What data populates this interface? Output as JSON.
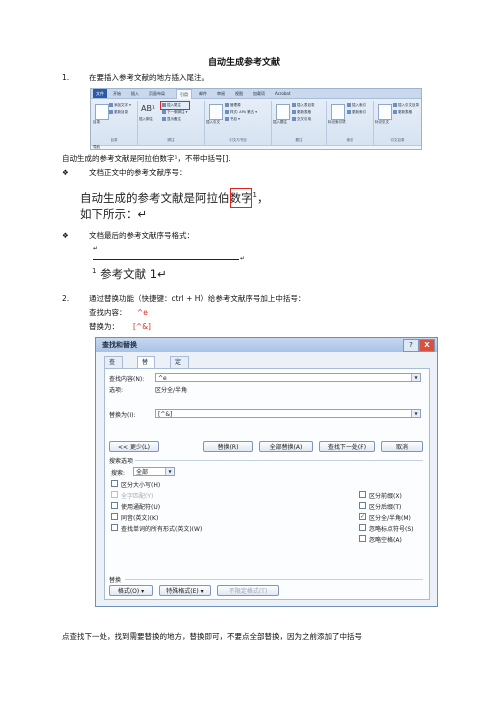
{
  "doc": {
    "title": "自动生成参考文献",
    "step1_num": "1.",
    "step1_text": "在要插入参考文献的地方插入尾注。",
    "para1": "自动生成的参考文献是阿拉伯数字¹，不带中括号[].",
    "bullet_symbol": "❖",
    "bullet1": "文档正文中的参考文献序号：",
    "excerpt1_line1": "自动生成的参考文献是阿拉伯数字",
    "excerpt1_sup": "1",
    "excerpt1_after": "，",
    "excerpt1_line2": "如下所示：↵",
    "bullet2": "文档最后的参考文献序号格式：",
    "excerpt2_mark": "↵",
    "excerpt2_ref_sup": "1",
    "excerpt2_ref_text": "参考文献 1↵",
    "excerpt2_rule_mark": "↵",
    "step2_num": "2.",
    "step2_text": "通过替换功能（快捷键：ctrl + H）给参考文献序号加上中括号：",
    "find_label": "查找内容：",
    "find_value": "^e",
    "replace_label": "替换为：",
    "replace_value": "[^&]",
    "footer_text": "点查找下一处，找到需要替换的地方，替换即可，不要点全部替换，因为之前添加了中括号"
  },
  "ribbon": {
    "tabs": [
      "文件",
      "开始",
      "插入",
      "页面布局",
      "引用",
      "邮件",
      "审阅",
      "视图",
      "加载项",
      "Acrobat"
    ],
    "active_tab": "引用",
    "groups": [
      "目录",
      "脚注",
      "引文与书目",
      "题注",
      "索引",
      "引文目录"
    ],
    "toc_big": "目录",
    "toc_items": [
      "添加文字 ▾",
      "更新目录"
    ],
    "footnote_big": "插入脚注",
    "footnote_items": [
      "插入尾注",
      "下一条脚注 ▾",
      "显示备注"
    ],
    "citation_big": "插入引文",
    "citation_items": [
      "管理源",
      "样式: APA 第五 ▾",
      "书目 ▾"
    ],
    "caption_big": "插入题注",
    "caption_items": [
      "插入表目录",
      "更新表格",
      "交叉引用"
    ],
    "index_big": "标记索引项",
    "index_items": [
      "插入索引",
      "更新索引"
    ],
    "toa_big": "标记引文",
    "toa_items": [
      "插入引文目录",
      "更新表格"
    ],
    "ruler": "导航"
  },
  "dialog": {
    "title": "查找和替换",
    "help": "?",
    "close": "X",
    "tabs": [
      "查找(D)",
      "替换(P)",
      "定位(G)"
    ],
    "active_tab": "替换(P)",
    "find_label": "查找内容(N):",
    "find_value": "^e",
    "options_label": "选项:",
    "options_value": "区分全/半角",
    "replace_label": "替换为(I):",
    "replace_value": "[^&]",
    "btn_less": "<< 更少(L)",
    "btn_replace": "替换(R)",
    "btn_replace_all": "全部替换(A)",
    "btn_find_next": "查找下一处(F)",
    "btn_cancel": "取消",
    "search_options_header": "搜索选项",
    "search_label": "搜索:",
    "search_value": "全部",
    "left_options": [
      {
        "label": "区分大小写(H)",
        "checked": false,
        "enabled": true
      },
      {
        "label": "全字匹配(Y)",
        "checked": false,
        "enabled": false
      },
      {
        "label": "使用通配符(U)",
        "checked": false,
        "enabled": true
      },
      {
        "label": "同音(英文)(K)",
        "checked": false,
        "enabled": true
      },
      {
        "label": "查找单词的所有形式(英文)(W)",
        "checked": false,
        "enabled": true
      }
    ],
    "right_options": [
      {
        "label": "区分前缀(X)",
        "checked": false,
        "enabled": true
      },
      {
        "label": "区分后缀(T)",
        "checked": false,
        "enabled": true
      },
      {
        "label": "区分全/半角(M)",
        "checked": true,
        "enabled": true
      },
      {
        "label": "忽略标点符号(S)",
        "checked": false,
        "enabled": true
      },
      {
        "label": "忽略空格(A)",
        "checked": false,
        "enabled": true
      }
    ],
    "replace_section": "替换",
    "btn_format": "格式(O) ▾",
    "btn_special": "特殊格式(E) ▾",
    "btn_no_format": "不限定格式(T)",
    "colors": {
      "accent": "#e0261c",
      "title_bar": "#a8c2e6",
      "close": "#d9503f"
    }
  }
}
